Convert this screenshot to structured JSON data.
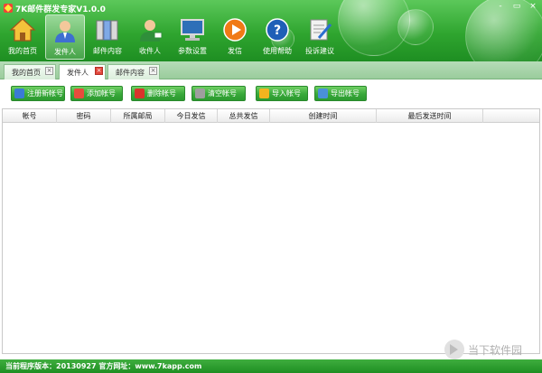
{
  "app": {
    "title": "7K邮件群发专家V1.0.0",
    "window_controls": [
      "-",
      "▭",
      "×"
    ]
  },
  "toolbar": {
    "items": [
      {
        "label": "我的首页",
        "icon": "home-icon",
        "active": false
      },
      {
        "label": "发件人",
        "icon": "sender-icon",
        "active": true
      },
      {
        "label": "邮件内容",
        "icon": "mail-content-icon",
        "active": false
      },
      {
        "label": "收件人",
        "icon": "recipient-icon",
        "active": false
      },
      {
        "label": "参数设置",
        "icon": "settings-monitor-icon",
        "active": false
      },
      {
        "label": "发信",
        "icon": "send-play-icon",
        "active": false
      },
      {
        "label": "使用帮助",
        "icon": "help-icon",
        "active": false
      },
      {
        "label": "投诉建议",
        "icon": "feedback-icon",
        "active": false
      }
    ]
  },
  "tabs": [
    {
      "label": "我的首页",
      "active": false
    },
    {
      "label": "发件人",
      "active": true
    },
    {
      "label": "邮件内容",
      "active": false
    }
  ],
  "actions": [
    {
      "label": "注册新帐号",
      "icon": "register-icon"
    },
    {
      "label": "添加帐号",
      "icon": "add-icon"
    },
    {
      "label": "删除帐号",
      "icon": "delete-icon"
    },
    {
      "label": "清空帐号",
      "icon": "clear-icon"
    },
    {
      "label": "导入帐号",
      "icon": "import-icon"
    },
    {
      "label": "导出帐号",
      "icon": "export-icon"
    }
  ],
  "table": {
    "columns": [
      "帐号",
      "密码",
      "所属邮局",
      "今日发信",
      "总共发信",
      "创建时间",
      "最后发送时间"
    ],
    "rows": []
  },
  "status": {
    "text": "当前程序版本：20130927   官方网址：www.7kapp.com"
  },
  "watermark": {
    "text": "当下软件园"
  }
}
